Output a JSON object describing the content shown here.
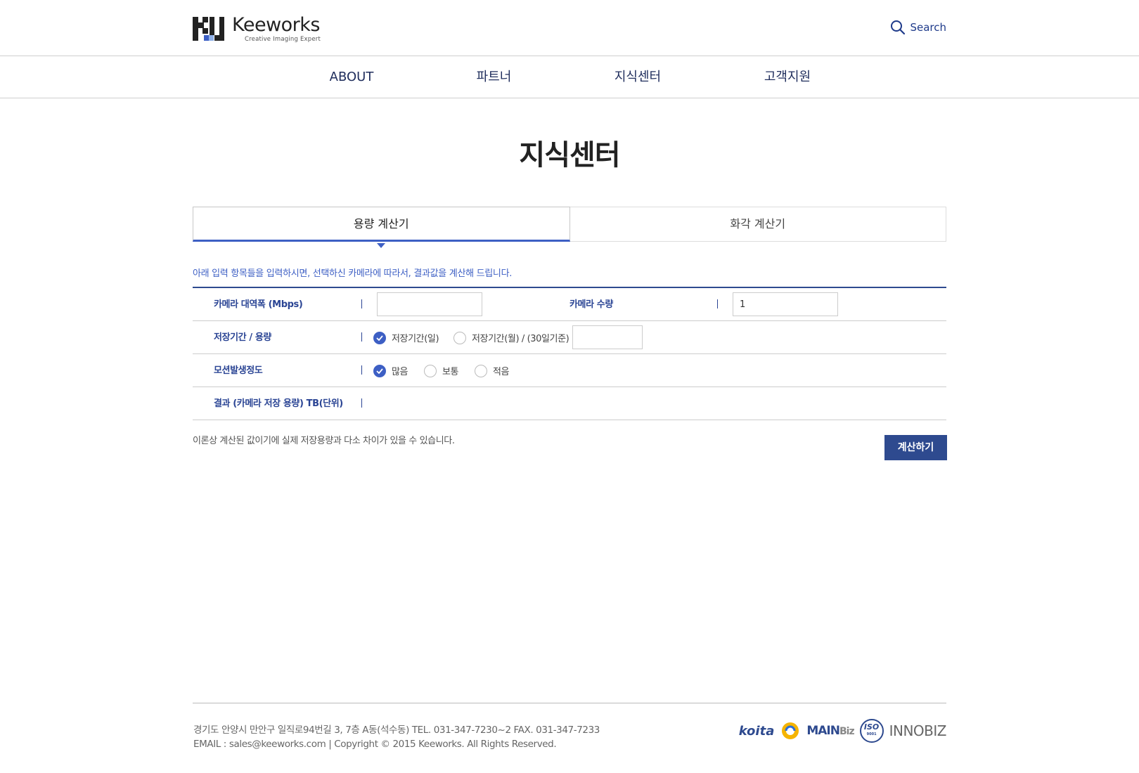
{
  "header": {
    "logo_name": "Keeworks",
    "logo_tagline": "Creative  Imaging  Expert",
    "search_label": "Search"
  },
  "nav": {
    "items": [
      {
        "label": "ABOUT"
      },
      {
        "label": "파트너"
      },
      {
        "label": "지식센터"
      },
      {
        "label": "고객지원"
      }
    ]
  },
  "page_title": "지식센터",
  "tabs": [
    {
      "label": "용량 계산기",
      "active": true
    },
    {
      "label": "화각 계산기",
      "active": false
    }
  ],
  "intro_text": "아래 입력 항목들을 입력하시면, 선택하신 카메라에 따라서, 결과값을 계산해 드립니다.",
  "form": {
    "bandwidth_label": "카메라 대역폭 (Mbps)",
    "bandwidth_value": "",
    "camera_count_label": "카메라 수량",
    "camera_count_value": "1",
    "storage_label": "저장기간 / 용량",
    "storage_option_days": "저장기간(일)",
    "storage_option_months": "저장기간(월) / (30일기준)",
    "storage_value": "",
    "motion_label": "모션발생정도",
    "motion_options": [
      "많음",
      "보통",
      "적음"
    ],
    "result_label": "결과 (카메라 저장 용량) TB(단위)",
    "result_value": ""
  },
  "note_text": "이론상 계산된 값이기에 실제 저장용량과 다소 차이가 있을 수 있습니다.",
  "calc_button": "계산하기",
  "footer": {
    "address_line": "경기도 안양시 만안구 일직로94번길 3, 7층 A동(석수동)    TEL. 031-347-7230~2  FAX. 031-347-7233",
    "email_line": "EMAIL : sales@keeworks.com | Copyright © 2015 Keeworks. All Rights Reserved.",
    "cert_logos": {
      "koita": "koita",
      "mainbiz_main": "MAIN",
      "mainbiz_biz": "Biz",
      "iso": "ISO",
      "iso_sub": "9001",
      "innobiz": "INNOBIZ"
    }
  },
  "colors": {
    "accent": "#3d5fc4",
    "navy": "#2e4a8f",
    "label_blue": "#2a4494"
  }
}
